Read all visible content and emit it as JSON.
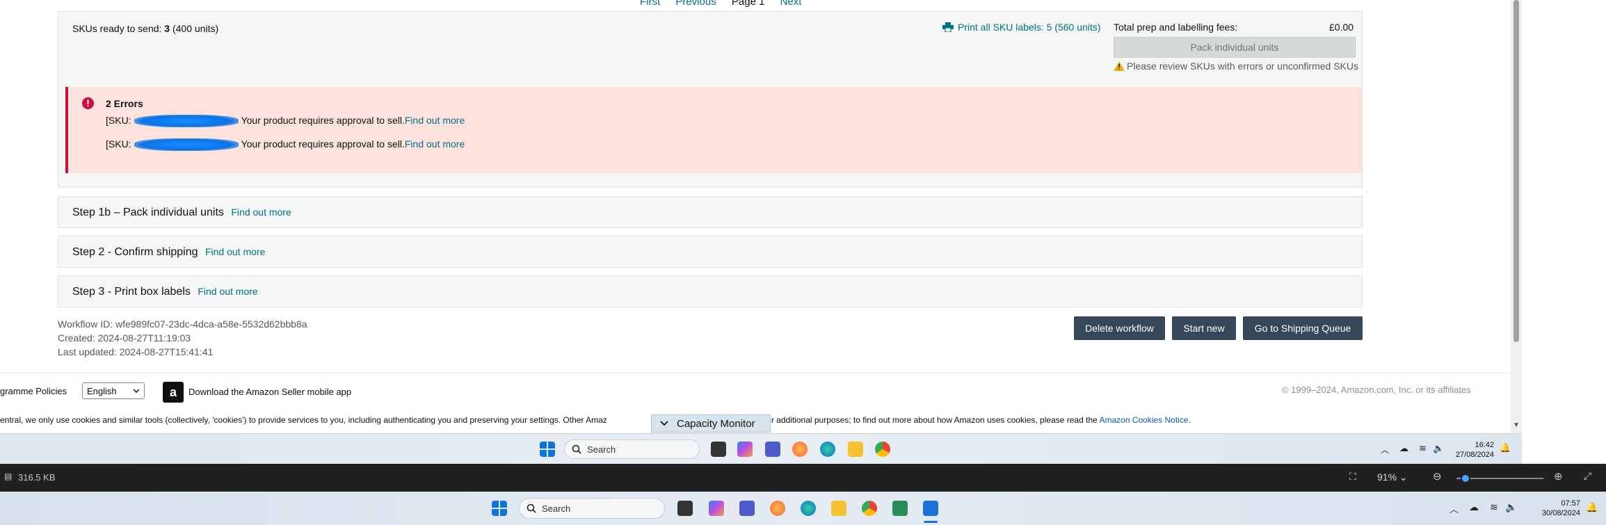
{
  "pager": {
    "first": "First",
    "previous": "Previous",
    "page": "Page 1",
    "next": "Next"
  },
  "panel": {
    "sku_ready_label": "SKUs ready to send:",
    "sku_ready_count": "3",
    "sku_ready_units": "(400 units)",
    "print_all": "Print all SKU labels: 5 (560 units)",
    "fees_label": "Total prep and labelling fees:",
    "fees_value": "£0.00",
    "pack_button": "Pack individual units",
    "review_note": "Please review SKUs with errors or unconfirmed SKUs"
  },
  "errors": {
    "title": "2 Errors",
    "rows": [
      {
        "prefix": "[SKU:",
        "message": "Your product requires approval to sell.",
        "link": "Find out more"
      },
      {
        "prefix": "[SKU:",
        "message": "Your product requires approval to sell.",
        "link": "Find out more"
      }
    ]
  },
  "steps": [
    {
      "title": "Step 1b – Pack individual units",
      "link": "Find out more"
    },
    {
      "title": "Step 2 - Confirm shipping",
      "link": "Find out more"
    },
    {
      "title": "Step 3 - Print box labels",
      "link": "Find out more"
    }
  ],
  "meta": {
    "workflow_id": "Workflow ID: wfe989fc07-23dc-4dca-a58e-5532d62bbb8a",
    "created": "Created: 2024-08-27T11:19:03",
    "updated": "Last updated: 2024-08-27T15:41:41"
  },
  "actions": {
    "delete": "Delete workflow",
    "start": "Start new",
    "queue": "Go to Shipping Queue"
  },
  "footer": {
    "policies": "gramme Policies",
    "language": "English",
    "download_app": "Download the Amazon Seller mobile app",
    "copyright": "© 1999–2024, Amazon.com, Inc. or its affiliates",
    "cookie_text_start": "entral, we only use cookies and similar tools (collectively, 'cookies') to provide services to you, including authenticating you and preserving your settings. Other Amaz",
    "cookie_text_end": "e cookies for additional purposes; to find out more about how Amazon uses cookies, please read the",
    "cookie_link": "Amazon Cookies Notice."
  },
  "capacity_monitor": "Capacity Monitor",
  "inner_taskbar": {
    "search_placeholder": "Search",
    "time": "16:42",
    "date": "27/08/2024"
  },
  "viewer": {
    "file_size": "316.5 KB",
    "zoom": "91%",
    "zoom_fraction": 0.1
  },
  "outer_taskbar": {
    "search_placeholder": "Search",
    "time": "07:57",
    "date": "30/08/2024"
  },
  "colors": {
    "link": "#007185",
    "error_bg": "#fde2dd",
    "error_border": "#cc0c39",
    "dark_button": "#37475a"
  }
}
